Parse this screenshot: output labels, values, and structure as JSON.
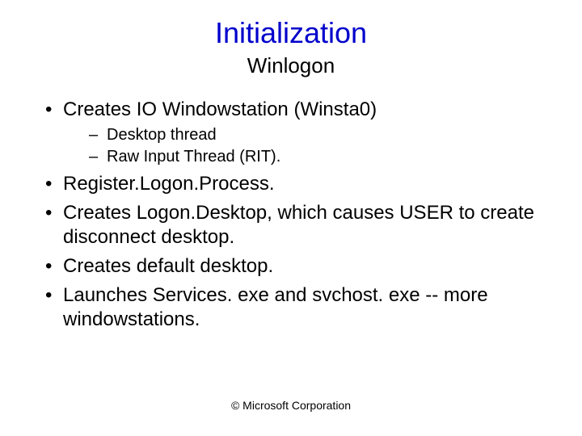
{
  "title": "Initialization",
  "subtitle": "Winlogon",
  "bullets": {
    "b0": "Creates IO Windowstation (Winsta0)",
    "b0_sub0": "Desktop thread",
    "b0_sub1": "Raw  Input Thread (RIT).",
    "b1": "Register.Logon.Process.",
    "b2": "Creates Logon.Desktop, which causes USER to create disconnect desktop.",
    "b3": "Creates default desktop.",
    "b4": "Launches Services. exe and svchost. exe -- more windowstations."
  },
  "footer": "© Microsoft Corporation"
}
